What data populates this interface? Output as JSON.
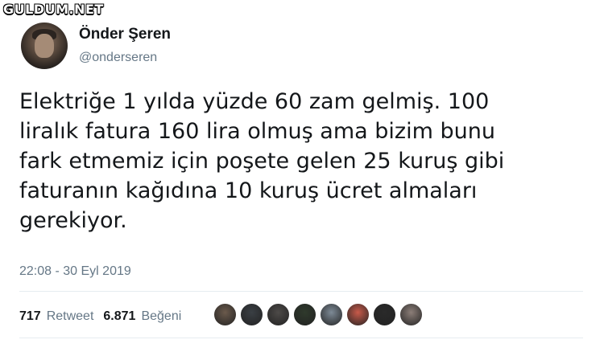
{
  "watermark": "GULDUM.NET",
  "user": {
    "display_name": "Önder Şeren",
    "handle": "@onderseren"
  },
  "tweet": {
    "lines": [
      "Elektriğe 1 yılda yüzde 60 zam gelmiş. 100",
      "liralık fatura 160 lira olmuş ama bizim bunu",
      "fark etmemiz için poşete gelen 25 kuruş gibi",
      "faturanın kağıdına 10 kuruş ücret almaları",
      "gerekiyor."
    ],
    "timestamp": "22:08 - 30 Eyl 2019"
  },
  "stats": {
    "retweet_count": "717",
    "retweet_label": "Retweet",
    "like_count": "6.871",
    "like_label": "Beğeni"
  },
  "likers": [
    {
      "name": "liker-avatar-1",
      "color": "#6b5a4c"
    },
    {
      "name": "liker-avatar-2",
      "color": "#3a3f44"
    },
    {
      "name": "liker-avatar-3",
      "color": "#4d4a48"
    },
    {
      "name": "liker-avatar-4",
      "color": "#2f3a2c"
    },
    {
      "name": "liker-avatar-5",
      "color": "#7d8a96"
    },
    {
      "name": "liker-avatar-6",
      "color": "#c85a4a"
    },
    {
      "name": "liker-avatar-7",
      "color": "#2a2a2a"
    },
    {
      "name": "liker-avatar-8",
      "color": "#8c7e78"
    }
  ]
}
